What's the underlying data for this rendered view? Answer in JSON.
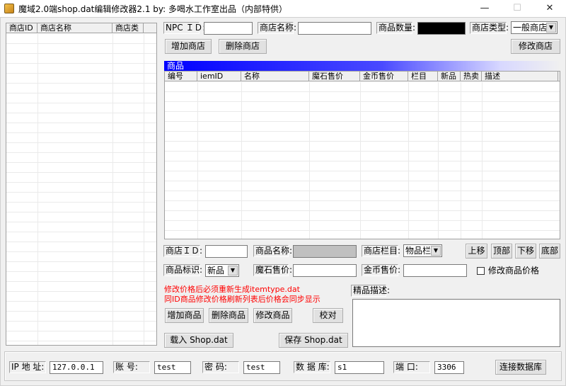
{
  "window": {
    "title": "魔域2.0端shop.dat编辑修改器2.1  by: 多喝水工作室出品（内部特供）",
    "minimize_glyph": "—",
    "maximize_glyph": "☐",
    "close_glyph": "✕"
  },
  "shop_list": {
    "columns": [
      "商店ID",
      "商店名称",
      "商店类"
    ]
  },
  "shop_form": {
    "npc_id_label": "NPC ＩＤ:",
    "npc_id_value": "",
    "shop_name_label": "商店名称:",
    "shop_name_value": "",
    "item_count_label": "商品数量:",
    "shop_type_label": "商店类型:",
    "shop_type_value": "一般商店",
    "add_shop": "增加商店",
    "delete_shop": "删除商店",
    "modify_shop": "修改商店"
  },
  "items_section": {
    "title": "商品",
    "columns": [
      "编号",
      "iemID",
      "名称",
      "魔石售价",
      "金币售价",
      "栏目",
      "新品",
      "热卖",
      "描述"
    ]
  },
  "item_form": {
    "shop_id_label": "商店ＩＤ:",
    "shop_id_value": "",
    "item_name_label": "商品名称:",
    "item_name_value": "",
    "shop_column_label": "商店栏目:",
    "shop_column_value": "物品栏",
    "move_up": "上移",
    "move_top": "顶部",
    "move_down": "下移",
    "move_bottom": "底部",
    "item_flag_label": "商品标识:",
    "item_flag_value": "新品",
    "gem_price_label": "魔石售价:",
    "gem_price_value": "",
    "gold_price_label": "金币售价:",
    "gold_price_value": "",
    "modify_price_checkbox": "修改商品价格",
    "modify_price_checked": false,
    "warning_line1": "修改价格后必须重新生成itemtype.dat",
    "warning_line2": "同ID商品修改价格刷新列表后价格会同步显示",
    "add_item": "增加商品",
    "delete_item": "删除商品",
    "modify_item": "修改商品",
    "verify": "校对",
    "load_file": "载入 Shop.dat",
    "save_file": "保存 Shop.dat",
    "desc_label": "精品描述:",
    "desc_value": ""
  },
  "db": {
    "ip_label": "IP 地 址:",
    "ip_value": "127.0.0.1",
    "account_label": "账    号:",
    "account_value": "test",
    "password_label": "密    码:",
    "password_value": "test",
    "database_label": "数 据 库:",
    "database_value": "s1",
    "port_label": "端    口:",
    "port_value": "3306",
    "connect": "连接数据库"
  }
}
